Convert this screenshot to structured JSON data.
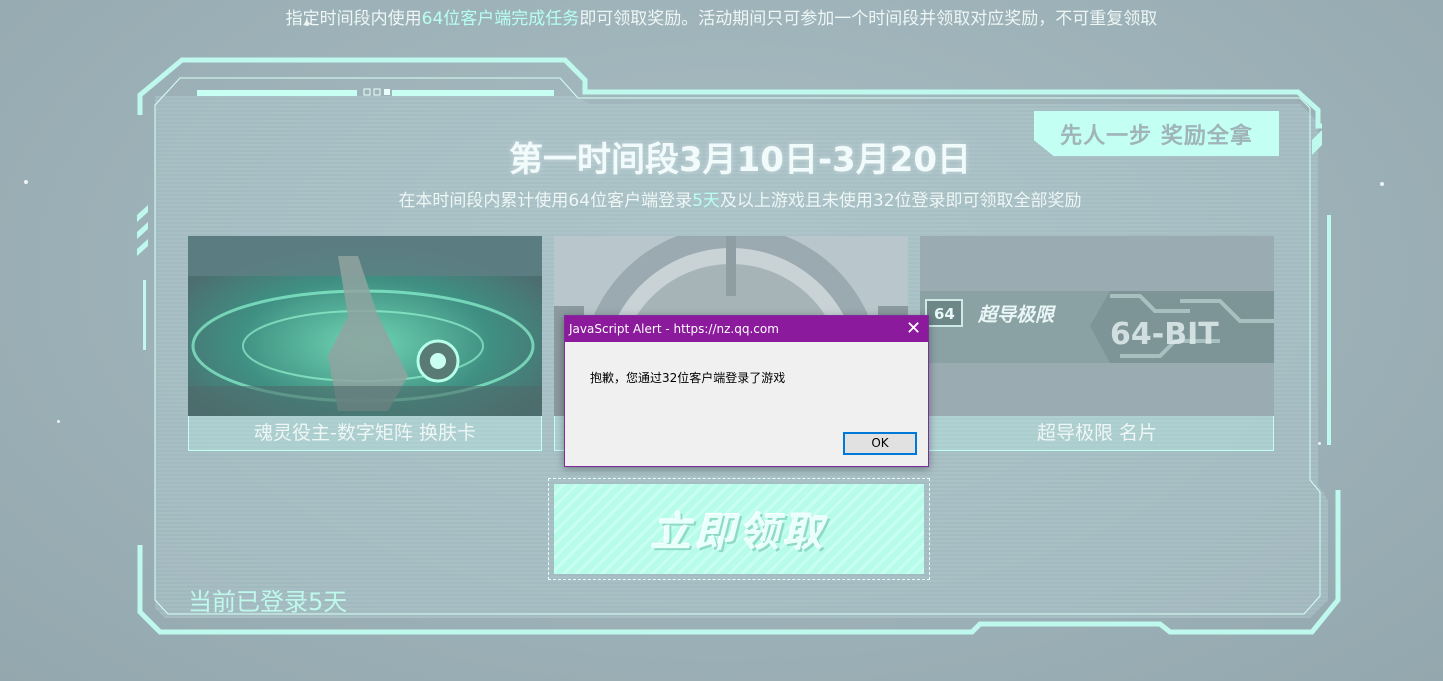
{
  "notice": {
    "pre": "指定时间段内使用",
    "highlight": "64位客户端完成任务",
    "post": "即可领取奖励。活动期间只可参加一个时间段并领取对应奖励，不可重复领取"
  },
  "period": {
    "title": "第一时间段3月10日-3月20日",
    "desc_pre": "在本时间段内累计使用64位客户端登录",
    "desc_highlight": "5天",
    "desc_post": "及以上游戏且未使用32位登录即可领取全部奖励",
    "badge": "先人一步 奖励全拿"
  },
  "rewards": [
    {
      "caption": "魂灵役主-数字矩阵 换肤卡"
    },
    {
      "caption": ""
    },
    {
      "caption": "超导极限 名片",
      "banner_text": "超导极限",
      "banner_logo": "64",
      "banner_tag": "64-BIT"
    }
  ],
  "claim_button": "立即领取",
  "login_days": "当前已登录5天",
  "dialog": {
    "title": "JavaScript Alert - https://nz.qq.com",
    "message": "抱歉，您通过32位客户端登录了游戏",
    "ok_label": "OK",
    "close_glyph": "✕"
  },
  "colors": {
    "accent": "#c3fff2",
    "highlight_text": "#b8fff2",
    "dialog_titlebar": "#8b1b9c"
  }
}
